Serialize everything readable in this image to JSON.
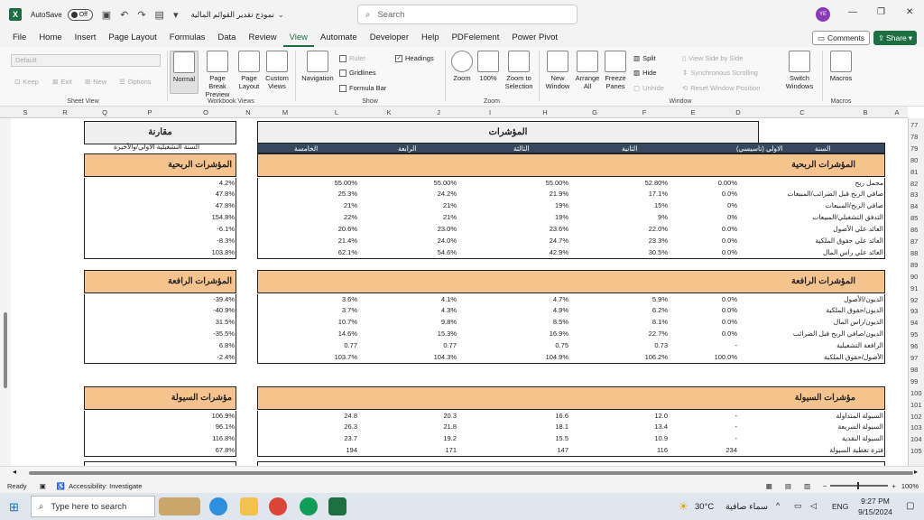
{
  "titlebar": {
    "app_logo": "X",
    "autosave_label": "AutoSave",
    "autosave_state": "Off",
    "doc_title": "نموذج تقدير القوائم المالية",
    "search_placeholder": "Search",
    "avatar": "YE",
    "minimize": "—",
    "maximize": "❐",
    "close": "✕"
  },
  "menu": [
    "File",
    "Home",
    "Insert",
    "Page Layout",
    "Formulas",
    "Data",
    "Review",
    "View",
    "Automate",
    "Developer",
    "Help",
    "PDFelement",
    "Power Pivot"
  ],
  "menu_active": "View",
  "comments_label": "Comments",
  "share_label": "Share",
  "ribbon": {
    "sheet_view": {
      "dropdown": "Default",
      "keep": "Keep",
      "exit": "Exit",
      "new": "New",
      "options": "Options",
      "label": "Sheet View"
    },
    "workbook_views": {
      "normal": "Normal",
      "page_break": "Page Break Preview",
      "page_layout": "Page Layout",
      "custom_views": "Custom Views",
      "label": "Workbook Views"
    },
    "show": {
      "navigation": "Navigation",
      "ruler": "Ruler",
      "gridlines": "Gridlines",
      "formula_bar": "Formula Bar",
      "headings": "Headings",
      "label": "Show"
    },
    "zoom": {
      "zoom": "Zoom",
      "zoom100": "100%",
      "zoom_sel": "Zoom to Selection",
      "label": "Zoom"
    },
    "window": {
      "new_window": "New Window",
      "arrange": "Arrange All",
      "freeze": "Freeze Panes",
      "split": "Split",
      "hide": "Hide",
      "unhide": "Unhide",
      "side": "View Side by Side",
      "sync": "Synchronous Scrolling",
      "reset": "Reset Window Position",
      "switch": "Switch Windows",
      "label": "Window"
    },
    "macros": {
      "macros": "Macros",
      "label": "Macros"
    }
  },
  "columns": [
    "S",
    "R",
    "Q",
    "P",
    "O",
    "N",
    "M",
    "L",
    "K",
    "J",
    "I",
    "H",
    "G",
    "F",
    "E",
    "D",
    "C",
    "B",
    "A"
  ],
  "rows": [
    "77",
    "78",
    "79",
    "80",
    "81",
    "82",
    "83",
    "84",
    "85",
    "86",
    "87",
    "88",
    "89",
    "90",
    "91",
    "92",
    "93",
    "94",
    "95",
    "96",
    "97",
    "98",
    "99",
    "100",
    "101",
    "102",
    "103",
    "104",
    "105"
  ],
  "left": {
    "title": "مقارنة",
    "subtitle": "السنة التشغيلية الاولي/والأخيرة",
    "sections": [
      {
        "title": "المؤشرات الربحية",
        "values": [
          "4.2%",
          "47.8%",
          "47.8%",
          "154.8%",
          "-6.1%",
          "-8.3%",
          "103.8%"
        ]
      },
      {
        "title": "المؤشرات الرافعة",
        "values": [
          "-39.4%",
          "-40.9%",
          "31.5%",
          "-35.5%",
          "6.8%",
          "-2.4%"
        ]
      },
      {
        "title": "مؤشرات السيولة",
        "values": [
          "106.9%",
          "96.1%",
          "116.8%",
          "67.8%"
        ]
      }
    ]
  },
  "main": {
    "title": "المؤشرات",
    "headers": [
      "السنة",
      "الاولي (تاسيسي)",
      "الثانية",
      "الثالثة",
      "الرابعة",
      "الخامسة"
    ],
    "sections": [
      {
        "title": "المؤشرات الربحية",
        "rows": [
          [
            "مجمل ربح",
            "0.00%",
            "52.80%",
            "55.00%",
            "55.00%",
            "55.00%"
          ],
          [
            "صافي الربح قبل الضرائب/المبيعات",
            "0.0%",
            "17.1%",
            "21.9%",
            "24.2%",
            "25.3%"
          ],
          [
            "صافي الربح/المبيعات",
            "0%",
            "15%",
            "19%",
            "21%",
            "21%"
          ],
          [
            "التدفق التشغيلي/المبيعات",
            "0%",
            "9%",
            "19%",
            "21%",
            "22%"
          ],
          [
            "العائد علي الأصول",
            "0.0%",
            "22.0%",
            "23.6%",
            "23.0%",
            "20.6%"
          ],
          [
            "العائد علي حقوق الملكية",
            "0.0%",
            "23.3%",
            "24.7%",
            "24.0%",
            "21.4%"
          ],
          [
            "العائد علي راس المال",
            "0.0%",
            "30.5%",
            "42.9%",
            "54.6%",
            "62.1%"
          ]
        ]
      },
      {
        "title": "المؤشرات الرافعة",
        "rows": [
          [
            "الديون/الأصول",
            "0.0%",
            "5.9%",
            "4.7%",
            "4.1%",
            "3.6%"
          ],
          [
            "الديون/حقوق الملكية",
            "0.0%",
            "6.2%",
            "4.9%",
            "4.3%",
            "3.7%"
          ],
          [
            "الديون/راس المال",
            "0.0%",
            "8.1%",
            "8.5%",
            "9.8%",
            "10.7%"
          ],
          [
            "الديون/صافي الربح قبل الضرائب",
            "0.0%",
            "22.7%",
            "16.9%",
            "15.3%",
            "14.6%"
          ],
          [
            "الرافعة التشغيلية",
            "-",
            "0.73",
            "0.75",
            "0.77",
            "0.77"
          ],
          [
            "الأصول/حقوق الملكية",
            "100.0%",
            "106.2%",
            "104.9%",
            "104.3%",
            "103.7%"
          ]
        ]
      },
      {
        "title": "مؤشرات السيولة",
        "rows": [
          [
            "السيولة المتداولة",
            "-",
            "12.0",
            "16.6",
            "20.3",
            "24.8"
          ],
          [
            "السيولة السريعة",
            "-",
            "13.4",
            "18.1",
            "21.8",
            "26.3"
          ],
          [
            "السيولة النقدية",
            "-",
            "10.9",
            "15.5",
            "19.2",
            "23.7"
          ],
          [
            "فترة تغطية السيولة",
            "234",
            "116",
            "147",
            "171",
            "194"
          ]
        ]
      }
    ]
  },
  "status": {
    "ready": "Ready",
    "accessibility": "Accessibility: Investigate",
    "zoom": "100%"
  },
  "taskbar": {
    "search": "Type here to search",
    "temp": "30°C",
    "weather": "سماء صافية",
    "lang": "ENG",
    "time": "9:27 PM",
    "date": "9/15/2024"
  }
}
